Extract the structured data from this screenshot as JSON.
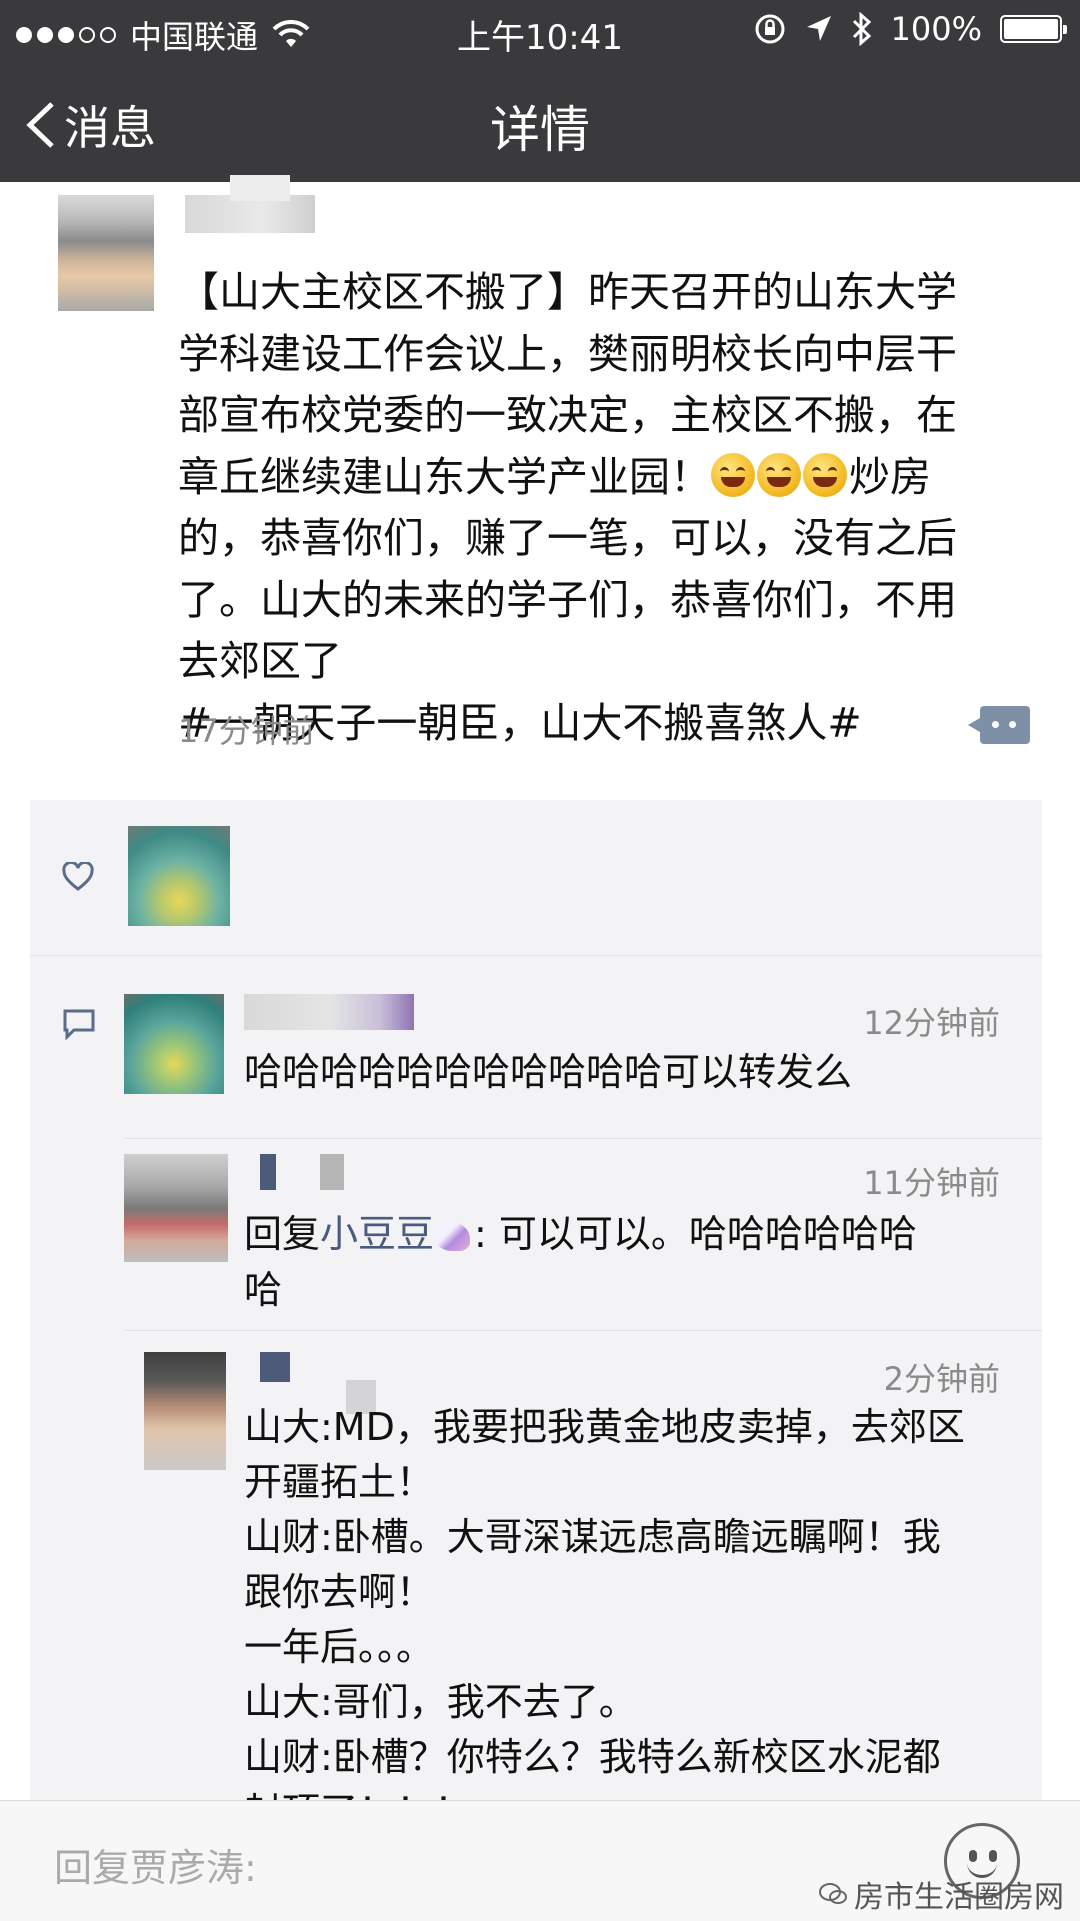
{
  "status_bar": {
    "carrier": "中国联通",
    "time": "上午10:41",
    "battery": "100%"
  },
  "nav": {
    "back_label": "消息",
    "title": "详情"
  },
  "post": {
    "text_lines": [
      "【山大主校区不搬了】昨天召开的山东大学",
      "学科建设工作会议上，樊丽明校长向中层干",
      "部宣布校党委的一致决定，主校区不搬，在",
      "章丘继续建山东大学产业园！",
      "炒房",
      "的，恭喜你们，赚了一笔，可以，没有之后",
      "了。山大的未来的学子们，恭喜你们，不用",
      "去郊区了",
      "#一朝天子一朝臣，山大不搬喜煞人#"
    ],
    "time": "17分钟前"
  },
  "comments": [
    {
      "time": "12分钟前",
      "text": "哈哈哈哈哈哈哈哈哈哈哈可以转发么"
    },
    {
      "time": "11分钟前",
      "prefix": "回复",
      "reply_to": "小豆豆",
      "text_line1": ": 可以可以。哈哈哈哈哈哈",
      "text_line2": "哈"
    },
    {
      "time": "2分钟前",
      "lines": [
        "山大:MD，我要把我黄金地皮卖掉，去郊区",
        "开疆拓土！",
        "山财:卧槽。大哥深谋远虑高瞻远瞩啊！我",
        "跟你去啊！",
        "一年后。。。",
        "山大:哥们，我不去了。",
        "山财:卧槽？你特么？我特么新校区水泥都",
        "封顶了！！！"
      ]
    }
  ],
  "reply_bar": {
    "placeholder": "回复贾彦涛:"
  },
  "watermark": "房市生活圈房网",
  "icons": {
    "back": "chevron-left-icon",
    "like": "heart-icon",
    "comment": "comment-icon",
    "more": "more-dots-icon",
    "emoji": "smiley-icon",
    "wifi": "wifi-icon",
    "location": "location-arrow-icon",
    "bluetooth": "bluetooth-icon",
    "lock": "orientation-lock-icon"
  }
}
